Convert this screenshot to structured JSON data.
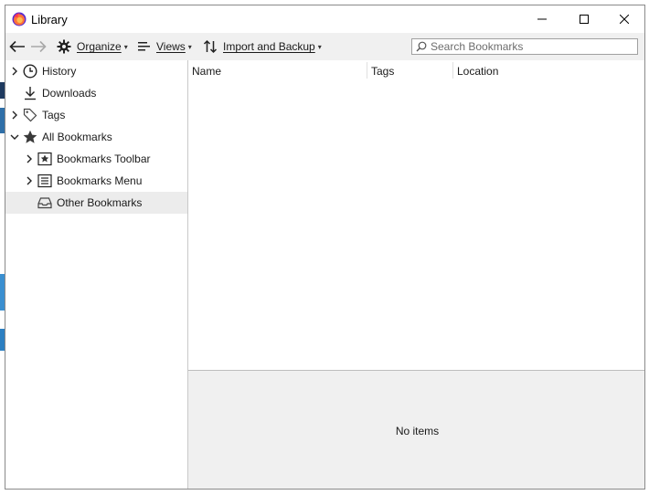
{
  "window": {
    "title": "Library",
    "controls": {
      "minimize": "minimize-icon",
      "maximize": "maximize-icon",
      "close": "close-icon"
    }
  },
  "toolbar": {
    "back": "back-arrow-icon",
    "forward": "forward-arrow-icon",
    "organize_label": "Organize",
    "views_label": "Views",
    "import_label": "Import and Backup",
    "caret": "▾",
    "search_placeholder": "Search Bookmarks"
  },
  "sidebar": {
    "items": [
      {
        "label": "History",
        "icon": "clock-icon",
        "expandable": true,
        "expanded": false
      },
      {
        "label": "Downloads",
        "icon": "download-icon",
        "expandable": false
      },
      {
        "label": "Tags",
        "icon": "tag-icon",
        "expandable": true,
        "expanded": false
      },
      {
        "label": "All Bookmarks",
        "icon": "star-icon",
        "expandable": true,
        "expanded": true
      },
      {
        "label": "Bookmarks Toolbar",
        "icon": "bookmarks-toolbar-icon",
        "expandable": true,
        "expanded": false
      },
      {
        "label": "Bookmarks Menu",
        "icon": "bookmarks-menu-icon",
        "expandable": true,
        "expanded": false
      },
      {
        "label": "Other Bookmarks",
        "icon": "tray-icon",
        "expandable": false,
        "selected": true
      }
    ]
  },
  "table": {
    "columns": [
      "Name",
      "Tags",
      "Location"
    ]
  },
  "details": {
    "empty_text": "No items"
  },
  "colors": {
    "toolbar_bg": "#f0f0f0",
    "selected_row": "#ececec",
    "details_bg": "#f0f0f0",
    "firefox_orange": "#ff7139",
    "firefox_purple": "#5a2bcf"
  }
}
